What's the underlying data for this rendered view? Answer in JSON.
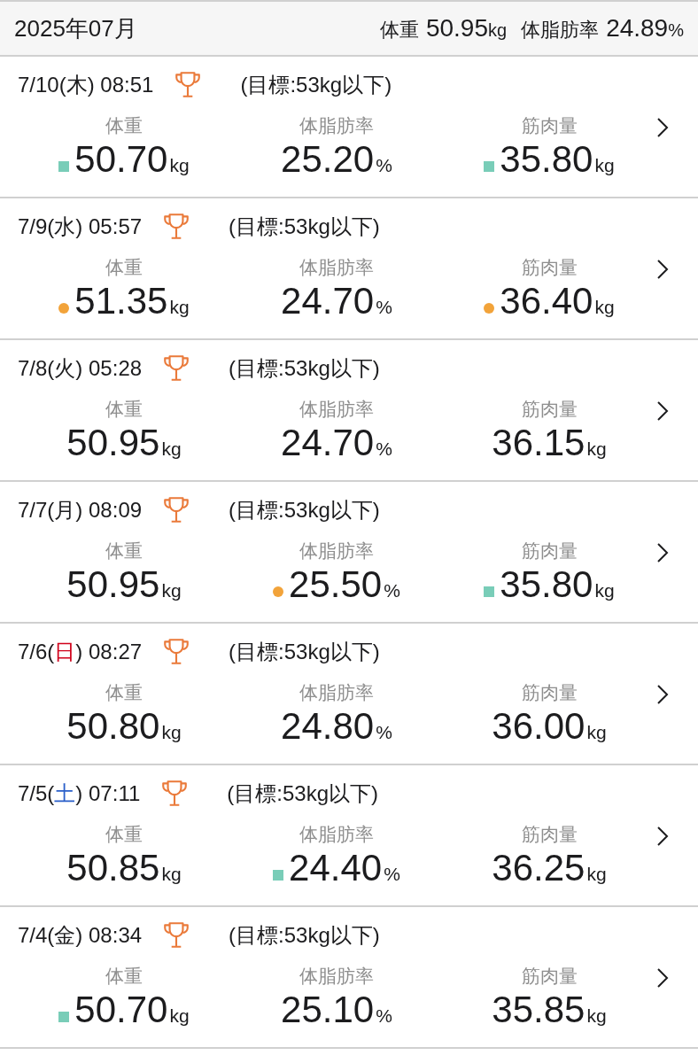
{
  "header": {
    "month": "2025年07月",
    "summary": [
      {
        "label": "体重",
        "value": "50.95",
        "unit": "kg"
      },
      {
        "label": "体脂肪率",
        "value": "24.89",
        "unit": "%"
      }
    ]
  },
  "entries": [
    {
      "date": "7/10(",
      "day": {
        "text": "木",
        "color": "#1c1c1e"
      },
      "time": ") 08:51",
      "goal": "(目標:53kg以下)",
      "metrics": [
        {
          "kind": "square",
          "label": "体重",
          "value": "50.70",
          "unit": "kg"
        },
        {
          "kind": "plain",
          "label": "体脂肪率",
          "value": "25.20",
          "unit": "%"
        },
        {
          "kind": "square",
          "label": "筋肉量",
          "value": "35.80",
          "unit": "kg"
        }
      ]
    },
    {
      "date": "7/9(",
      "day": {
        "text": "水",
        "color": "#1c1c1e"
      },
      "time": ") 05:57",
      "goal": "(目標:53kg以下)",
      "metrics": [
        {
          "kind": "dot",
          "label": "体重",
          "value": "51.35",
          "unit": "kg"
        },
        {
          "kind": "plain",
          "label": "体脂肪率",
          "value": "24.70",
          "unit": "%"
        },
        {
          "kind": "dot",
          "label": "筋肉量",
          "value": "36.40",
          "unit": "kg"
        }
      ]
    },
    {
      "date": "7/8(",
      "day": {
        "text": "火",
        "color": "#1c1c1e"
      },
      "time": ") 05:28",
      "goal": "(目標:53kg以下)",
      "metrics": [
        {
          "kind": "plain",
          "label": "体重",
          "value": "50.95",
          "unit": "kg"
        },
        {
          "kind": "plain",
          "label": "体脂肪率",
          "value": "24.70",
          "unit": "%"
        },
        {
          "kind": "plain",
          "label": "筋肉量",
          "value": "36.15",
          "unit": "kg"
        }
      ]
    },
    {
      "date": "7/7(",
      "day": {
        "text": "月",
        "color": "#1c1c1e"
      },
      "time": ") 08:09",
      "goal": "(目標:53kg以下)",
      "metrics": [
        {
          "kind": "plain",
          "label": "体重",
          "value": "50.95",
          "unit": "kg"
        },
        {
          "kind": "dot",
          "label": "体脂肪率",
          "value": "25.50",
          "unit": "%"
        },
        {
          "kind": "square",
          "label": "筋肉量",
          "value": "35.80",
          "unit": "kg"
        }
      ]
    },
    {
      "date": "7/6(",
      "day": {
        "text": "日",
        "color": "#d0021b"
      },
      "time": ") 08:27",
      "goal": "(目標:53kg以下)",
      "metrics": [
        {
          "kind": "plain",
          "label": "体重",
          "value": "50.80",
          "unit": "kg"
        },
        {
          "kind": "plain",
          "label": "体脂肪率",
          "value": "24.80",
          "unit": "%"
        },
        {
          "kind": "plain",
          "label": "筋肉量",
          "value": "36.00",
          "unit": "kg"
        }
      ]
    },
    {
      "date": "7/5(",
      "day": {
        "text": "土",
        "color": "#2a5fc9"
      },
      "time": ") 07:11",
      "goal": "(目標:53kg以下)",
      "metrics": [
        {
          "kind": "plain",
          "label": "体重",
          "value": "50.85",
          "unit": "kg"
        },
        {
          "kind": "square",
          "label": "体脂肪率",
          "value": "24.40",
          "unit": "%"
        },
        {
          "kind": "plain",
          "label": "筋肉量",
          "value": "36.25",
          "unit": "kg"
        }
      ]
    },
    {
      "date": "7/4(",
      "day": {
        "text": "金",
        "color": "#1c1c1e"
      },
      "time": ") 08:34",
      "goal": "(目標:53kg以下)",
      "metrics": [
        {
          "kind": "square",
          "label": "体重",
          "value": "50.70",
          "unit": "kg"
        },
        {
          "kind": "plain",
          "label": "体脂肪率",
          "value": "25.10",
          "unit": "%"
        },
        {
          "kind": "plain",
          "label": "筋肉量",
          "value": "35.85",
          "unit": "kg"
        }
      ]
    }
  ]
}
